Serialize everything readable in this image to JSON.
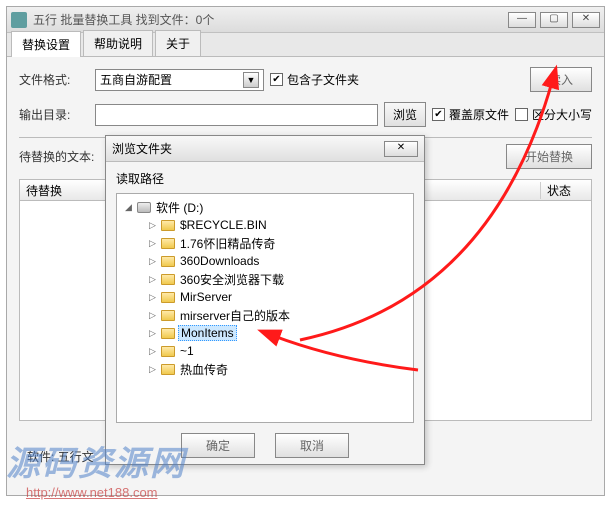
{
  "window": {
    "title": "五行 批量替换工具  找到文件：0个"
  },
  "tabs": [
    "替换设置",
    "帮助说明",
    "关于"
  ],
  "labels": {
    "file_format": "文件格式:",
    "output_dir": "输出目录:",
    "replace_text": "待替换的文本:",
    "software": "软件: 五行文"
  },
  "file_format_value": "五商自游配置",
  "checkboxes": {
    "include_sub": "包含子文件夹",
    "overwrite": "覆盖原文件",
    "case_sensitive": "区分大小写"
  },
  "buttons": {
    "read": "读入",
    "browse": "浏览",
    "start_replace": "开始替换",
    "ok": "确定",
    "cancel": "取消"
  },
  "columns": {
    "pending": "待替换",
    "status": "状态"
  },
  "dialog": {
    "title": "浏览文件夹",
    "path_label": "读取路径"
  },
  "tree": {
    "root": "软件 (D:)",
    "items": [
      "$RECYCLE.BIN",
      "1.76怀旧精品传奇",
      "360Downloads",
      "360安全浏览器下载",
      "MirServer",
      "mirserver自己的版本",
      "MonItems",
      "~1",
      "热血传奇"
    ],
    "selected_index": 6
  },
  "watermark": {
    "text": "源码资源网",
    "url": "http://www.net188.com"
  }
}
